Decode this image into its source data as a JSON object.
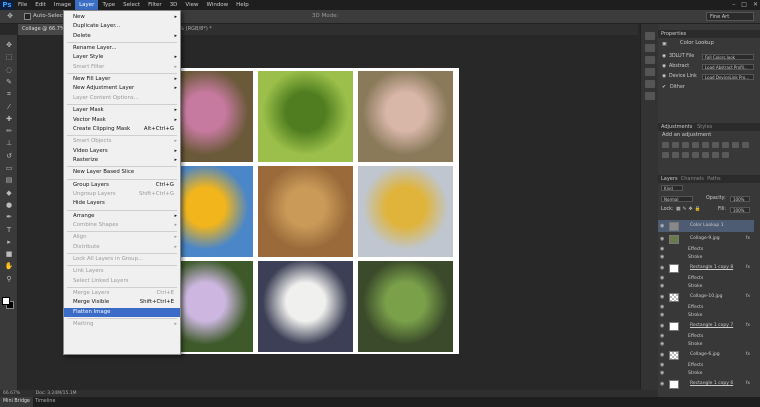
{
  "app": {
    "logo": "Ps"
  },
  "menubar": [
    {
      "label": "File",
      "active": false
    },
    {
      "label": "Edit",
      "active": false
    },
    {
      "label": "Image",
      "active": false
    },
    {
      "label": "Layer",
      "active": true
    },
    {
      "label": "Type",
      "active": false
    },
    {
      "label": "Select",
      "active": false
    },
    {
      "label": "Filter",
      "active": false
    },
    {
      "label": "3D",
      "active": false
    },
    {
      "label": "View",
      "active": false
    },
    {
      "label": "Window",
      "active": false
    },
    {
      "label": "Help",
      "active": false
    }
  ],
  "window_controls": [
    "–",
    "□",
    "✕"
  ],
  "options_bar": {
    "auto_select": "Auto-Select:",
    "mode_3d": "3D Mode:",
    "workspace": "Fine Art"
  },
  "tabs": [
    {
      "label": "Collage @ 66.7% (Color Lookup 1, RGB/8) *",
      "active": true
    },
    {
      "label": "rage-9.jpg @ 100% (RGB/8*) *",
      "active": false
    }
  ],
  "tools": [
    "move-icon",
    "marquee-icon",
    "lasso-icon",
    "quick-select-icon",
    "crop-icon",
    "eyedropper-icon",
    "healing-icon",
    "brush-icon",
    "stamp-icon",
    "history-brush-icon",
    "eraser-icon",
    "gradient-icon",
    "blur-icon",
    "dodge-icon",
    "pen-icon",
    "type-icon",
    "path-select-icon",
    "shape-icon",
    "hand-icon",
    "zoom-icon"
  ],
  "menu": [
    {
      "label": "New",
      "arrow": true
    },
    {
      "label": "Duplicate Layer..."
    },
    {
      "label": "Delete",
      "arrow": true
    },
    {
      "sep": true
    },
    {
      "label": "Rename Layer..."
    },
    {
      "label": "Layer Style",
      "arrow": true
    },
    {
      "label": "Smart Filter",
      "arrow": true,
      "disabled": true
    },
    {
      "sep": true
    },
    {
      "label": "New Fill Layer",
      "arrow": true
    },
    {
      "label": "New Adjustment Layer",
      "arrow": true
    },
    {
      "label": "Layer Content Options...",
      "disabled": true
    },
    {
      "sep": true
    },
    {
      "label": "Layer Mask",
      "arrow": true
    },
    {
      "label": "Vector Mask",
      "arrow": true
    },
    {
      "label": "Create Clipping Mask",
      "shortcut": "Alt+Ctrl+G"
    },
    {
      "sep": true
    },
    {
      "label": "Smart Objects",
      "arrow": true,
      "disabled": true
    },
    {
      "label": "Video Layers",
      "arrow": true
    },
    {
      "label": "Rasterize",
      "arrow": true
    },
    {
      "sep": true
    },
    {
      "label": "New Layer Based Slice"
    },
    {
      "sep": true
    },
    {
      "label": "Group Layers",
      "shortcut": "Ctrl+G"
    },
    {
      "label": "Ungroup Layers",
      "shortcut": "Shift+Ctrl+G",
      "disabled": true
    },
    {
      "label": "Hide Layers"
    },
    {
      "sep": true
    },
    {
      "label": "Arrange",
      "arrow": true
    },
    {
      "label": "Combine Shapes",
      "arrow": true,
      "disabled": true
    },
    {
      "sep": true
    },
    {
      "label": "Align",
      "arrow": true,
      "disabled": true
    },
    {
      "label": "Distribute",
      "arrow": true,
      "disabled": true
    },
    {
      "sep": true
    },
    {
      "label": "Lock All Layers in Group...",
      "disabled": true
    },
    {
      "sep": true
    },
    {
      "label": "Link Layers",
      "disabled": true
    },
    {
      "label": "Select Linked Layers",
      "disabled": true
    },
    {
      "sep": true
    },
    {
      "label": "Merge Layers",
      "shortcut": "Ctrl+E",
      "disabled": true
    },
    {
      "label": "Merge Visible",
      "shortcut": "Shift+Ctrl+E"
    },
    {
      "label": "Flatten Image",
      "highlighted": true
    },
    {
      "sep": true
    },
    {
      "label": "Matting",
      "arrow": true,
      "disabled": true
    }
  ],
  "tiles": [
    {
      "name": "iris-photo",
      "bg": "#6b5a3a",
      "fg": "#c77aa0"
    },
    {
      "name": "fern-photo",
      "bg": "#9bbf4a",
      "fg": "#4f7d1f"
    },
    {
      "name": "grass-photo",
      "bg": "#8a7a5a",
      "fg": "#d8b6a8"
    },
    {
      "name": "sunflower-photo",
      "bg": "#4a86c8",
      "fg": "#f2b51c"
    },
    {
      "name": "leaf-photo",
      "bg": "#9a6a3a",
      "fg": "#c99a58"
    },
    {
      "name": "branch-photo",
      "bg": "#bfc6cf",
      "fg": "#e0b43a"
    },
    {
      "name": "passionflower-photo",
      "bg": "#3e5a2a",
      "fg": "#cdb7e0"
    },
    {
      "name": "calla-photo",
      "bg": "#3c3f55",
      "fg": "#f0f0ee"
    },
    {
      "name": "leaves-photo",
      "bg": "#3a4a2a",
      "fg": "#7aa04a"
    }
  ],
  "properties": {
    "title": "Properties",
    "header": "Color Lookup",
    "rows": [
      {
        "label": "3DLUT File",
        "value": "Fall Colors.look"
      },
      {
        "label": "Abstract",
        "value": "Load Abstract Profil..."
      },
      {
        "label": "Device Link",
        "value": "Load DeviceLink Pro..."
      }
    ],
    "dither": "Dither"
  },
  "adjustments": {
    "tabs": [
      "Adjustments",
      "Styles"
    ],
    "add": "Add an adjustment"
  },
  "layers_panel": {
    "tabs": [
      "Layers",
      "Channels",
      "Paths"
    ],
    "kind": "Kind",
    "blend": "Normal",
    "opacity_label": "Opacity:",
    "opacity": "100%",
    "lock_label": "Lock:",
    "fill_label": "Fill:",
    "fill": "100%",
    "layers": [
      {
        "name": "Color Lookup 1",
        "selected": true,
        "thumb": "adjust"
      },
      {
        "name": "Collage-9.jpg",
        "thumb": "photo",
        "fx": true
      },
      {
        "name": "Effects",
        "sub": true
      },
      {
        "name": "Stroke",
        "sub": true
      },
      {
        "name": "Rectangle 1 copy 8",
        "thumb": "white",
        "fx": true
      },
      {
        "name": "Effects",
        "sub": true
      },
      {
        "name": "Stroke",
        "sub": true
      },
      {
        "name": "Collage-10.jpg",
        "thumb": "checker",
        "fx": true
      },
      {
        "name": "Effects",
        "sub": true
      },
      {
        "name": "Stroke",
        "sub": true
      },
      {
        "name": "Rectangle 1 copy 7",
        "thumb": "white",
        "fx": true
      },
      {
        "name": "Effects",
        "sub": true
      },
      {
        "name": "Stroke",
        "sub": true
      },
      {
        "name": "Collage-6.jpg",
        "thumb": "checker",
        "fx": true
      },
      {
        "name": "Effects",
        "sub": true
      },
      {
        "name": "Stroke",
        "sub": true
      },
      {
        "name": "Rectangle 1 copy 6",
        "thumb": "white",
        "fx": true
      }
    ]
  },
  "status": {
    "zoom": "66.67%",
    "doc": "Doc: 3.24M/15.1M"
  },
  "bottom_tabs": [
    {
      "label": "Mini Bridge",
      "active": true
    },
    {
      "label": "Timeline",
      "active": false
    }
  ]
}
